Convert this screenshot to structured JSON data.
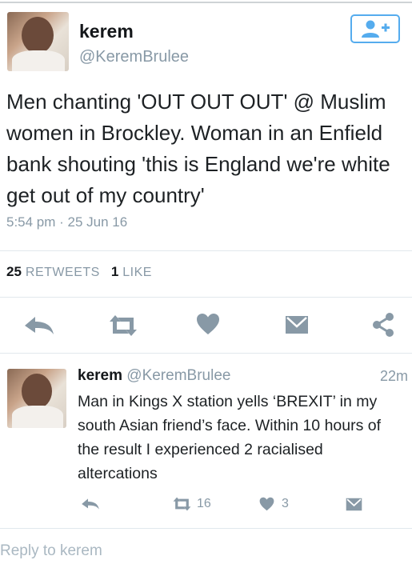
{
  "tweet": {
    "author_name": "kerem",
    "author_handle": "@KeremBrulee",
    "text": "Men chanting 'OUT OUT OUT' @ Muslim women in Brockley. Woman in an Enfield bank shouting 'this is England we're white get out of my country'",
    "timestamp": "5:54 pm · 25 Jun 16",
    "retweet_count": "25",
    "retweet_label": "RETWEETS",
    "like_count": "1",
    "like_label": "LIKE",
    "actions": [
      "reply-icon",
      "retweet-icon",
      "heart-icon",
      "direct-message-icon",
      "share-icon"
    ]
  },
  "reply": {
    "author_name": "kerem",
    "author_handle": "@KeremBrulee",
    "time_ago": "22m",
    "text": "Man in Kings X station yells ‘BREXIT’ in my south Asian friend’s face. Within 10 hours of the result I experienced 2 racialised altercations",
    "retweet_count": "16",
    "like_count": "3"
  },
  "reply_input": {
    "placeholder": "Reply to kerem"
  },
  "colors": {
    "accent": "#55acee",
    "icon_gray": "#8899a6",
    "text": "#14171a"
  }
}
